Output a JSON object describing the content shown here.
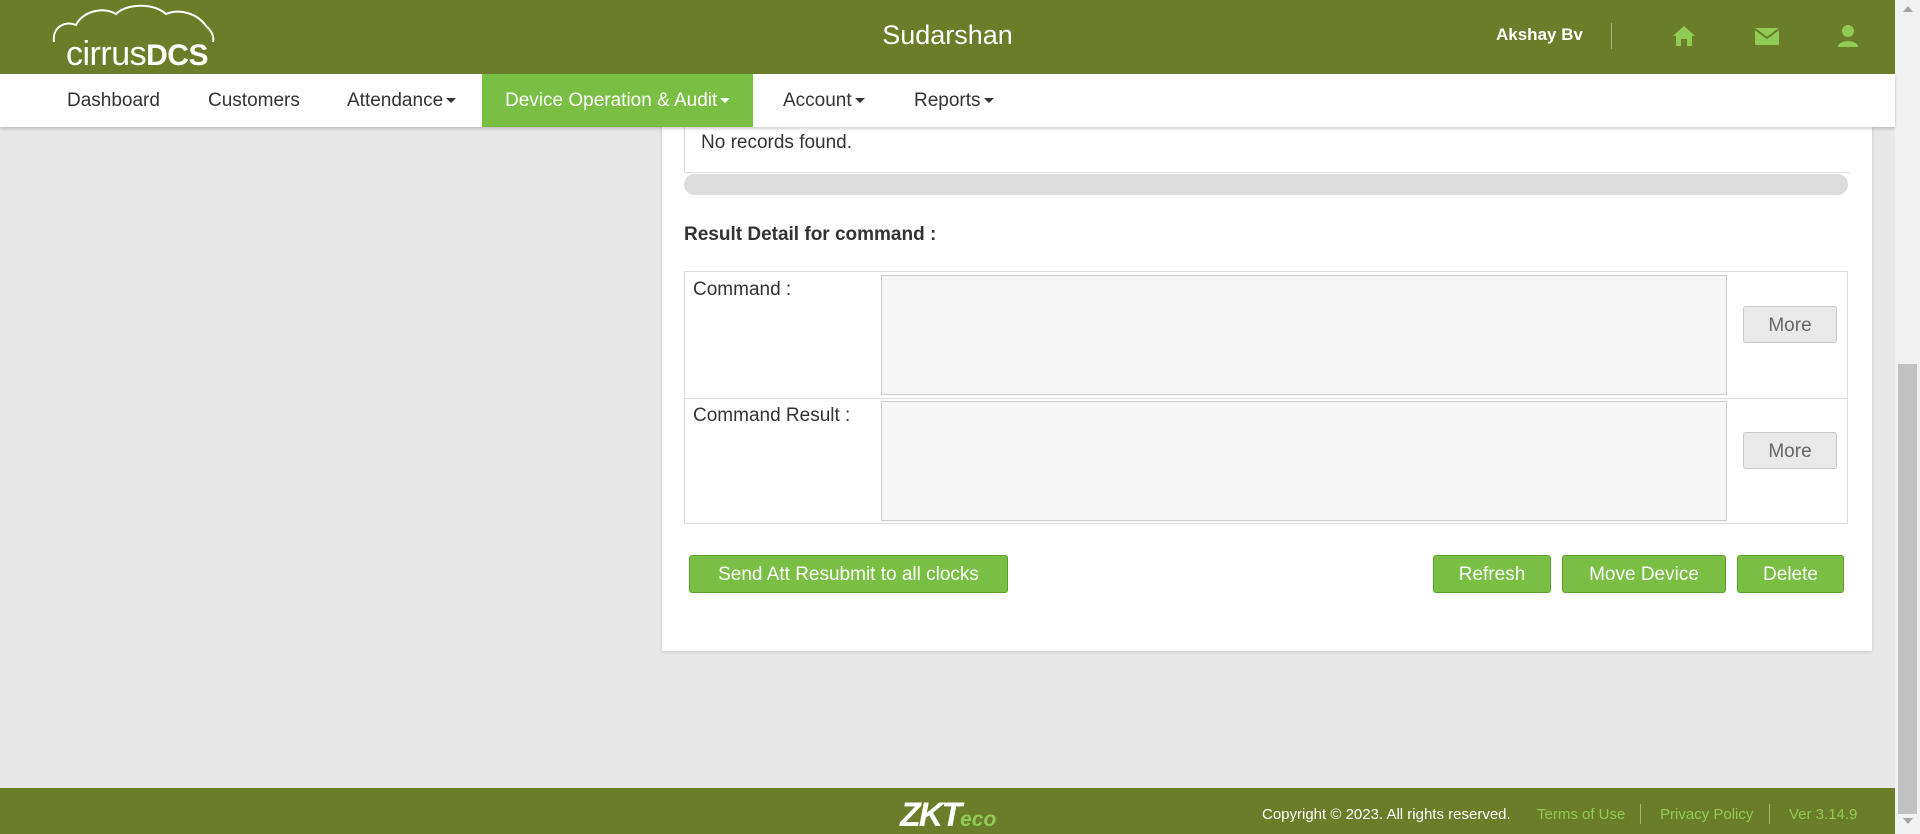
{
  "header": {
    "logo": {
      "light": "cirrus",
      "bold": "DCS"
    },
    "company_name": "Sudarshan",
    "user_name": "Akshay Bv",
    "icons": [
      "home-icon",
      "envelope-icon",
      "user-icon"
    ]
  },
  "nav": {
    "items": [
      {
        "label": "Dashboard",
        "dropdown": false
      },
      {
        "label": "Customers",
        "dropdown": false
      },
      {
        "label": "Attendance",
        "dropdown": true
      },
      {
        "label": "Device Operation & Audit",
        "dropdown": true,
        "active": true
      },
      {
        "label": "Account",
        "dropdown": true
      },
      {
        "label": "Reports",
        "dropdown": true
      }
    ]
  },
  "main": {
    "no_records": "No records found.",
    "result_title": "Result Detail for command :",
    "rows": [
      {
        "label": "Command :",
        "value": "",
        "more_label": "More"
      },
      {
        "label": "Command Result :",
        "value": "",
        "more_label": "More"
      }
    ],
    "buttons": {
      "send_resubmit": "Send Att Resubmit to all clocks",
      "refresh": "Refresh",
      "move_device": "Move Device",
      "delete": "Delete"
    }
  },
  "footer": {
    "logo": {
      "main": "ZKT",
      "suffix": "eco"
    },
    "copyright": "Copyright © 2023. All rights reserved.",
    "terms": "Terms of Use",
    "privacy": "Privacy Policy",
    "version": "Ver 3.14.9"
  },
  "colors": {
    "header_bg": "#6b7d28",
    "accent_green": "#78bf43",
    "link_green": "#8fcb55",
    "page_bg": "#e8e8e8"
  }
}
